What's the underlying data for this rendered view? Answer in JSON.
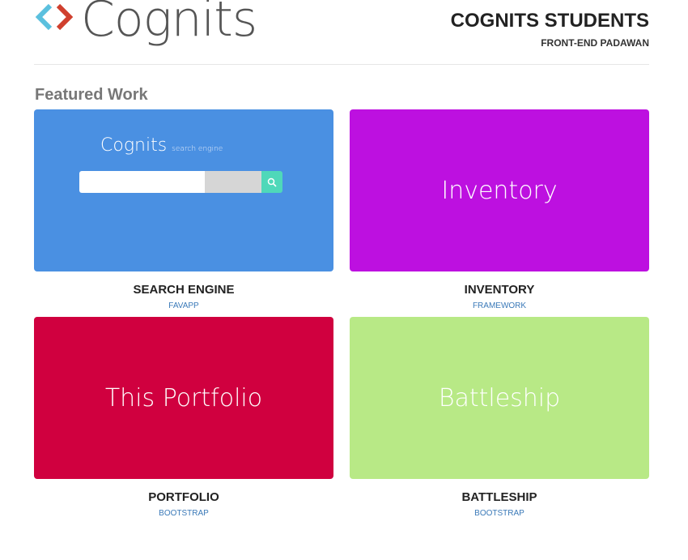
{
  "header": {
    "logo_text": "Cognits",
    "title": "COGNITS STUDENTS",
    "subtitle": "FRONT-END PADAWAN"
  },
  "featured": {
    "heading": "Featured Work",
    "cards": [
      {
        "name": "SEARCH ENGINE",
        "tag": "FAVAPP",
        "color": "#4a90e2",
        "preview_title": "Cognits",
        "preview_sub": "search engine"
      },
      {
        "name": "INVENTORY",
        "tag": "FRAMEWORK",
        "color": "#bd10e0",
        "preview": "Inventory"
      },
      {
        "name": "PORTFOLIO",
        "tag": "BOOTSTRAP",
        "color": "#d0003f",
        "preview": "This Portfolio"
      },
      {
        "name": "BATTLESHIP",
        "tag": "BOOTSTRAP",
        "color": "#b8e986",
        "preview": "Battleship"
      }
    ]
  },
  "colors": {
    "logo_left_chevron": "#5bc0de",
    "logo_right_chevron": "#d0402e",
    "search_button": "#4fd8b9"
  }
}
